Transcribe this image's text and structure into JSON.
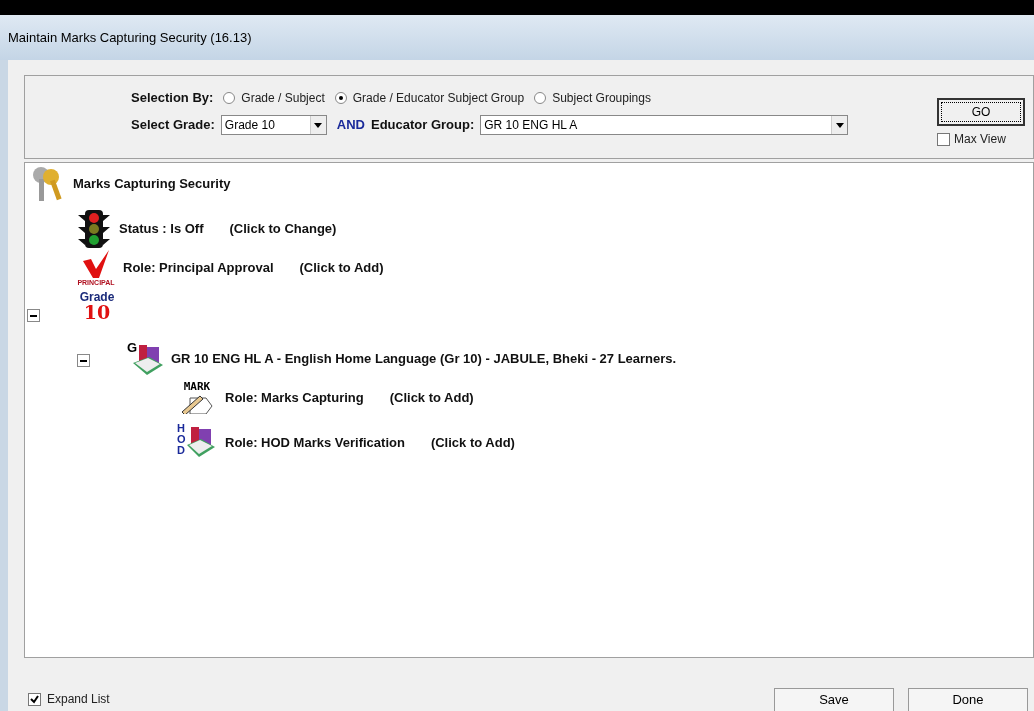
{
  "window": {
    "title": "Maintain Marks Capturing Security (16.13)"
  },
  "selection_by": {
    "label": "Selection By:",
    "options": [
      {
        "label": "Grade / Subject",
        "selected": false
      },
      {
        "label": "Grade / Educator Subject Group",
        "selected": true
      },
      {
        "label": "Subject Groupings",
        "selected": false
      }
    ]
  },
  "select_grade": {
    "label": "Select Grade:",
    "value": "Grade 10"
  },
  "and_label": "AND",
  "educator_group": {
    "label": "Educator Group:",
    "value": "GR 10 ENG HL A"
  },
  "go_button": "GO",
  "max_view": {
    "label": "Max View",
    "checked": false
  },
  "tree": {
    "kind": "keys",
    "label": "Marks Capturing Security",
    "children": [
      {
        "kind": "traffic_light",
        "label": "Status : Is Off",
        "action": "(Click to Change)"
      },
      {
        "kind": "principal",
        "icon_text": [
          "PRINCIPAL"
        ],
        "label": "Role: Principal Approval",
        "action": "(Click to Add)"
      },
      {
        "kind": "grade",
        "icon_text": [
          "Grade",
          "10"
        ],
        "expanded": true,
        "children": [
          {
            "kind": "book",
            "icon_text": [
              "G"
            ],
            "label": "GR 10 ENG HL A - English Home Language (Gr 10) - JABULE, Bheki - 27 Learners.",
            "expanded": true,
            "children": [
              {
                "kind": "mark",
                "icon_text": [
                  "MARK"
                ],
                "label": "Role: Marks Capturing",
                "action": "(Click to Add)"
              },
              {
                "kind": "hod",
                "icon_text": [
                  "HOD"
                ],
                "label": "Role: HOD Marks Verification",
                "action": "(Click to Add)"
              }
            ]
          }
        ]
      }
    ]
  },
  "expand_list": {
    "label": "Expand List",
    "checked": true
  },
  "buttons": [
    "Save",
    "Done"
  ]
}
